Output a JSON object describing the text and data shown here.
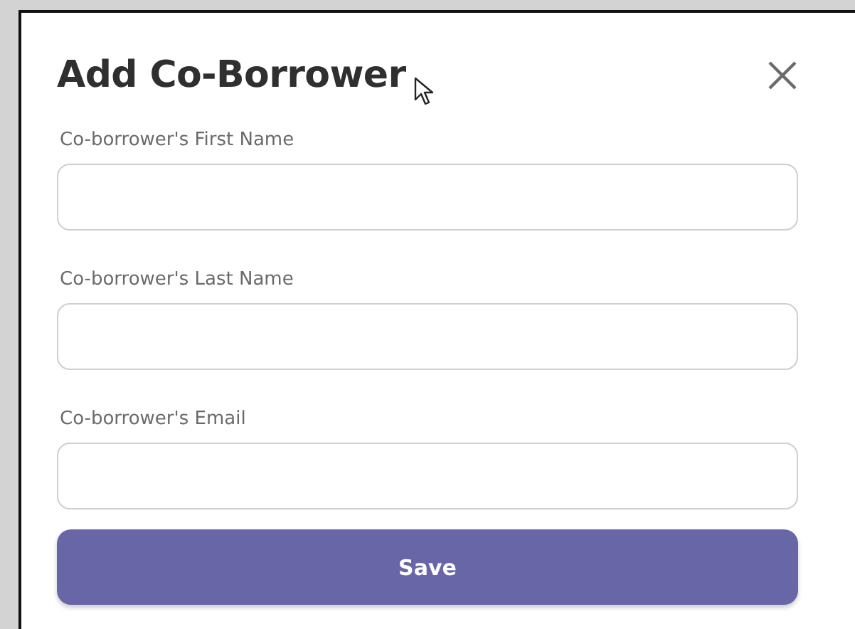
{
  "dialog": {
    "title": "Add Co-Borrower",
    "fields": [
      {
        "label": "Co-borrower's First Name"
      },
      {
        "label": "Co-borrower's Last Name"
      },
      {
        "label": "Co-borrower's Email"
      }
    ],
    "button": "Save"
  }
}
